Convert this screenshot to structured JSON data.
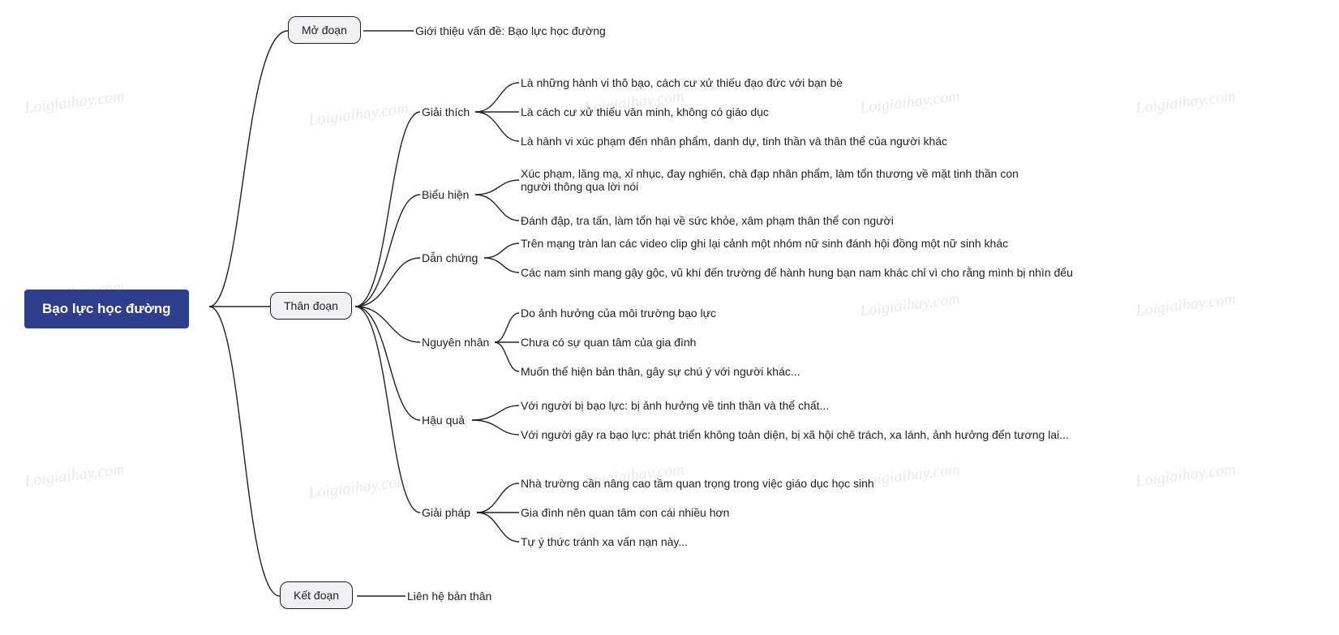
{
  "root": {
    "label": "Bạo lực học đường"
  },
  "sections": {
    "mo_doan": {
      "label": "Mở đoạn",
      "content": "Giới thiệu vấn đề: Bạo lực học đường"
    },
    "than_doan": {
      "label": "Thân đoạn",
      "branches": {
        "giai_thich": {
          "label": "Giải thích",
          "items": [
            "Là những hành vi thô bạo, cách cư xử thiếu đạo đức với bạn bè",
            "Là cách cư xử thiếu văn minh, không có giáo dục",
            "Là hành vi xúc phạm đến nhân phẩm, danh dự, tinh thần và thân thể của người khác"
          ]
        },
        "bieu_hien": {
          "label": "Biểu hiện",
          "items": [
            "Xúc phạm, lăng mạ, xỉ nhục, đay nghiến, chà đạp nhân phẩm, làm tổn thương về mặt tinh thần con người thông qua lời nói",
            "Đánh đập, tra tấn, làm tổn hại về sức khỏe, xâm phạm thân thể con người"
          ]
        },
        "dan_chung": {
          "label": "Dẫn chứng",
          "items": [
            "Trên mạng tràn lan các video clip ghi lại cảnh một nhóm nữ sinh đánh hội đồng một nữ sinh khác",
            "Các nam sinh mang gậy gộc, vũ khí đến trường để hành hung bạn nam khác chỉ vì cho rằng mình bị nhìn đểu"
          ]
        },
        "nguyen_nhan": {
          "label": "Nguyên nhân",
          "items": [
            "Do ảnh hưởng của môi trường bạo lực",
            "Chưa có sự quan tâm của gia đình",
            "Muốn thể hiện bản thân, gây sự chú ý với người khác..."
          ]
        },
        "hau_qua": {
          "label": "Hậu quả",
          "items": [
            "Với người bị bạo lực: bị ảnh hưởng về tinh thần và thể chất...",
            "Với người gây ra bạo lực: phát triển không toàn diện, bị xã hội chê trách, xa lánh, ảnh hưởng đến tương lai..."
          ]
        },
        "giai_phap": {
          "label": "Giải pháp",
          "items": [
            "Nhà trường cần nâng cao tầm quan trọng trong việc giáo dục học sinh",
            "Gia đình nên quan tâm con cái nhiều hơn",
            "Tự ý thức tránh xa vấn nạn này..."
          ]
        }
      }
    },
    "ket_doan": {
      "label": "Kết đoạn",
      "content": "Liên hệ bản thân"
    }
  },
  "watermark": "Loigiaihay.com"
}
